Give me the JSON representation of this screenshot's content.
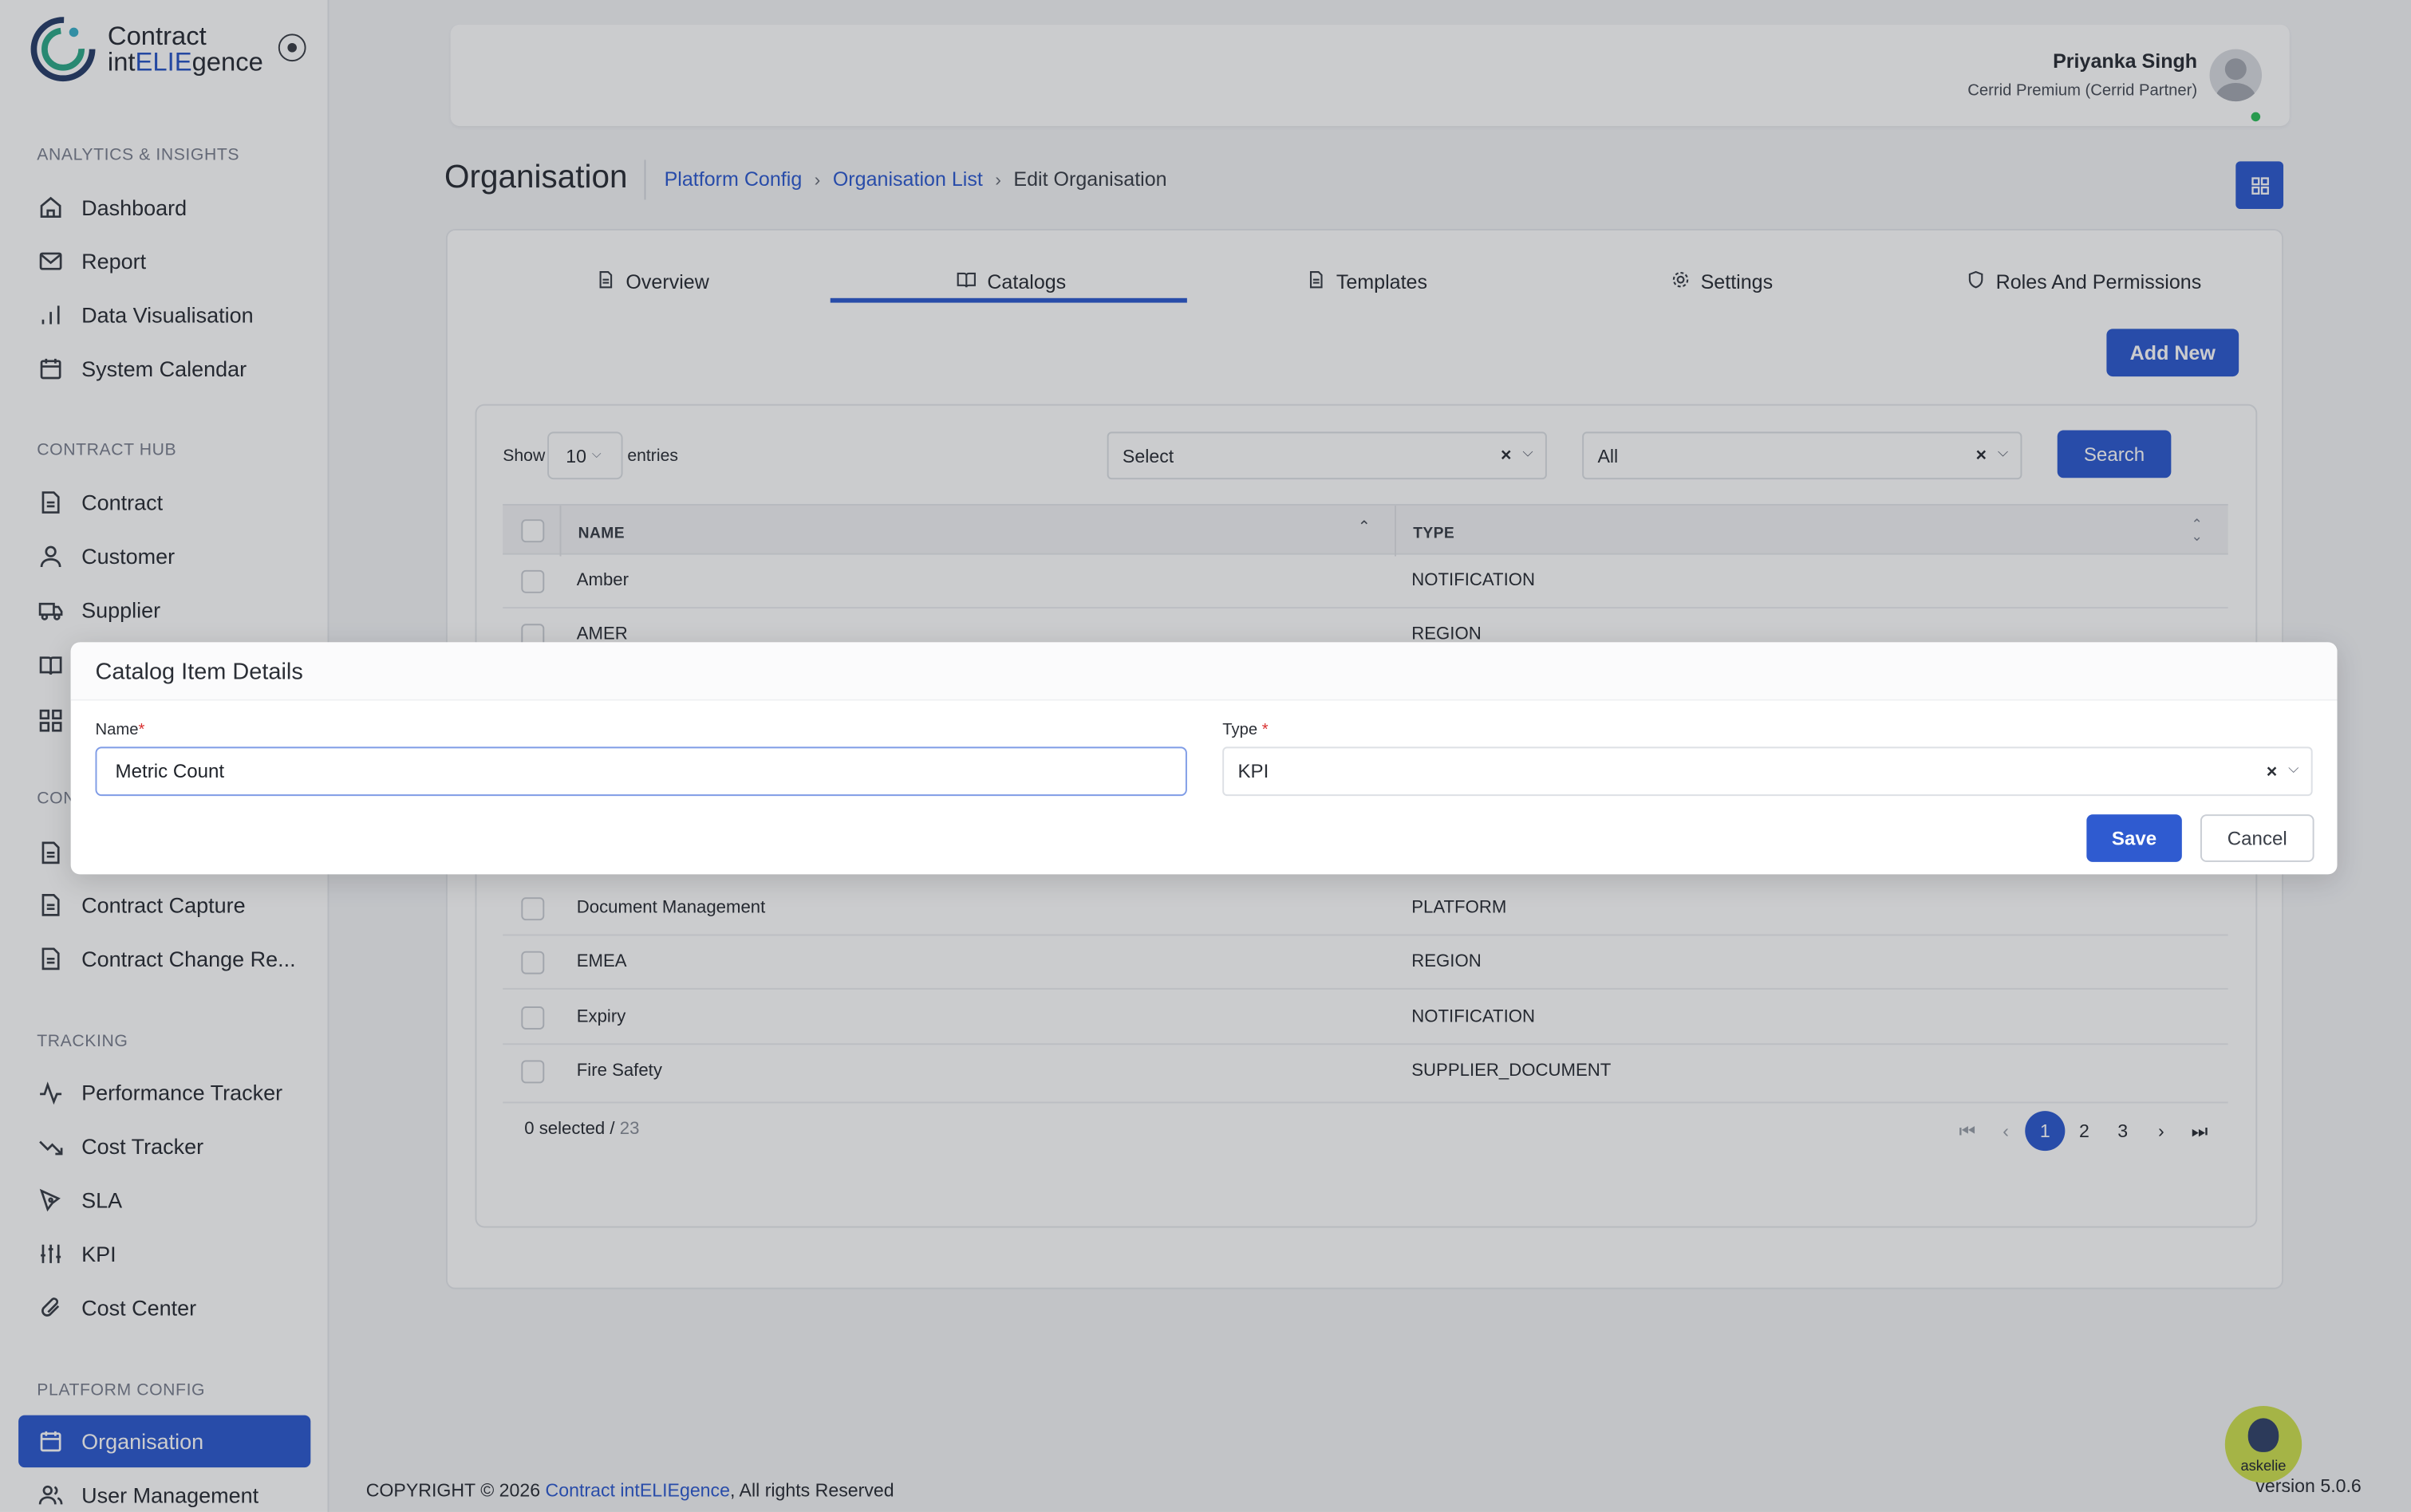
{
  "app": {
    "logo_line1": "Contract",
    "logo_line2_pre": "int",
    "logo_line2_hl": "ELIE",
    "logo_line2_post": "gence"
  },
  "sidebar": {
    "sections": {
      "analytics": "ANALYTICS & INSIGHTS",
      "contract_hub": "CONTRACT HUB",
      "con_partial": "CON",
      "tracking": "TRACKING",
      "platform_config": "PLATFORM CONFIG"
    },
    "items": {
      "dashboard": "Dashboard",
      "report": "Report",
      "data_visualisation": "Data Visualisation",
      "system_calendar": "System Calendar",
      "contract": "Contract",
      "customer": "Customer",
      "supplier": "Supplier",
      "contract_capture": "Contract Capture",
      "contract_change": "Contract Change Re...",
      "performance_tracker": "Performance Tracker",
      "cost_tracker": "Cost Tracker",
      "sla": "SLA",
      "kpi": "KPI",
      "cost_center": "Cost Center",
      "organisation": "Organisation",
      "user_management": "User Management"
    }
  },
  "user": {
    "name": "Priyanka Singh",
    "subtitle": "Cerrid Premium (Cerrid Partner)"
  },
  "header": {
    "title": "Organisation",
    "breadcrumb": [
      "Platform Config",
      "Organisation List",
      "Edit Organisation"
    ]
  },
  "tabs": [
    "Overview",
    "Catalogs",
    "Templates",
    "Settings",
    "Roles And Permissions"
  ],
  "catalogs": {
    "add_new": "Add New",
    "show_label": "Show",
    "entries_value": "10",
    "entries_label": "entries",
    "filter1": "Select",
    "filter2": "All",
    "search_btn": "Search",
    "col_name": "NAME",
    "col_type": "TYPE",
    "rows": [
      {
        "name": "Amber",
        "type": "NOTIFICATION"
      },
      {
        "name": "AMER",
        "type": "REGION"
      },
      {
        "name": "Document Management",
        "type": "PLATFORM"
      },
      {
        "name": "EMEA",
        "type": "REGION"
      },
      {
        "name": "Expiry",
        "type": "NOTIFICATION"
      },
      {
        "name": "Fire Safety",
        "type": "SUPPLIER_DOCUMENT"
      }
    ],
    "selected_text": "0 selected /",
    "total": "23",
    "pages": [
      "1",
      "2",
      "3"
    ]
  },
  "modal": {
    "title": "Catalog Item Details",
    "name_label": "Name",
    "name_value": "Metric Count",
    "type_label": "Type",
    "type_value": "KPI",
    "save": "Save",
    "cancel": "Cancel"
  },
  "footer": {
    "copyright_pre": "COPYRIGHT © 2026",
    "copyright_link": "Contract intELIEgence",
    "copyright_post": ", All rights Reserved",
    "version": "version 5.0.6",
    "assistant": "askelie"
  },
  "colors": {
    "primary": "#2f5bd0",
    "online": "#2fbf5c"
  }
}
